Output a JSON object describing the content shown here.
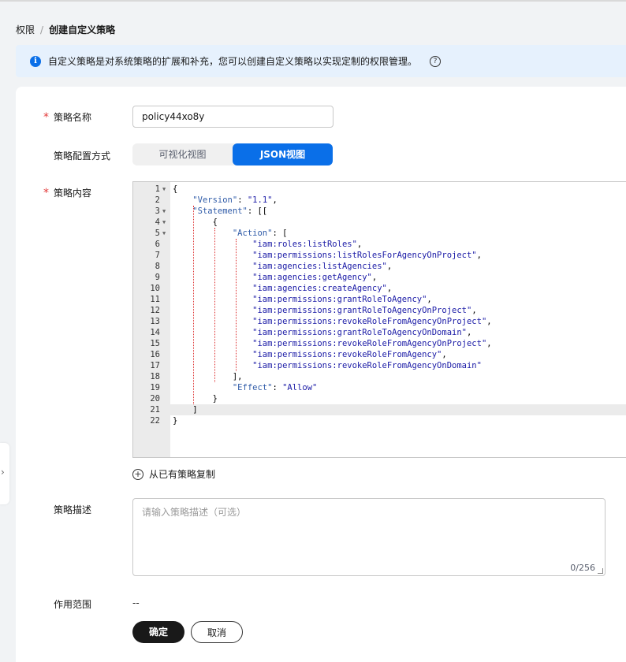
{
  "breadcrumb": {
    "parent": "权限",
    "separator": "/",
    "current": "创建自定义策略"
  },
  "notice": {
    "text": "自定义策略是对系统策略的扩展和补充，您可以创建自定义策略以实现定制的权限管理。"
  },
  "form": {
    "name_label": "策略名称",
    "name_value": "policy44xo8y",
    "mode_label": "策略配置方式",
    "mode_options": [
      "可视化视图",
      "JSON视图"
    ],
    "mode_selected": "JSON视图",
    "content_label": "策略内容",
    "copy_label": "从已有策略复制",
    "desc_label": "策略描述",
    "desc_placeholder": "请输入策略描述（可选）",
    "desc_count": "0/256",
    "scope_label": "作用范围",
    "scope_value": "--"
  },
  "editor": {
    "highlighted_line": 21,
    "lines": [
      {
        "n": "1",
        "fold": true,
        "text": "{"
      },
      {
        "n": "2",
        "fold": false,
        "text": "    \"Version\": \"1.1\","
      },
      {
        "n": "3",
        "fold": true,
        "text": "    \"Statement\": [["
      },
      {
        "n": "4",
        "fold": true,
        "text": "        {"
      },
      {
        "n": "5",
        "fold": true,
        "text": "            \"Action\": ["
      },
      {
        "n": "6",
        "fold": false,
        "text": "                \"iam:roles:listRoles\","
      },
      {
        "n": "7",
        "fold": false,
        "text": "                \"iam:permissions:listRolesForAgencyOnProject\","
      },
      {
        "n": "8",
        "fold": false,
        "text": "                \"iam:agencies:listAgencies\","
      },
      {
        "n": "9",
        "fold": false,
        "text": "                \"iam:agencies:getAgency\","
      },
      {
        "n": "10",
        "fold": false,
        "text": "                \"iam:agencies:createAgency\","
      },
      {
        "n": "11",
        "fold": false,
        "text": "                \"iam:permissions:grantRoleToAgency\","
      },
      {
        "n": "12",
        "fold": false,
        "text": "                \"iam:permissions:grantRoleToAgencyOnProject\","
      },
      {
        "n": "13",
        "fold": false,
        "text": "                \"iam:permissions:revokeRoleFromAgencyOnProject\","
      },
      {
        "n": "14",
        "fold": false,
        "text": "                \"iam:permissions:grantRoleToAgencyOnDomain\","
      },
      {
        "n": "15",
        "fold": false,
        "text": "                \"iam:permissions:revokeRoleFromAgencyOnProject\","
      },
      {
        "n": "16",
        "fold": false,
        "text": "                \"iam:permissions:revokeRoleFromAgency\","
      },
      {
        "n": "17",
        "fold": false,
        "text": "                \"iam:permissions:revokeRoleFromAgencyOnDomain\""
      },
      {
        "n": "18",
        "fold": false,
        "text": "            ],"
      },
      {
        "n": "19",
        "fold": false,
        "text": "            \"Effect\": \"Allow\""
      },
      {
        "n": "20",
        "fold": false,
        "text": "        }"
      },
      {
        "n": "21",
        "fold": false,
        "text": "    ]"
      },
      {
        "n": "22",
        "fold": false,
        "text": "}"
      }
    ]
  },
  "buttons": {
    "ok": "确定",
    "cancel": "取消"
  },
  "icons": {
    "info": "info-icon",
    "help": "help-icon",
    "add": "plus-circle-icon",
    "expand": "chevron-right-icon"
  },
  "colors": {
    "primary": "#0a6fe8",
    "required": "#e23a3a",
    "dark_button": "#191919",
    "notice_bg": "#e6f1fd"
  }
}
